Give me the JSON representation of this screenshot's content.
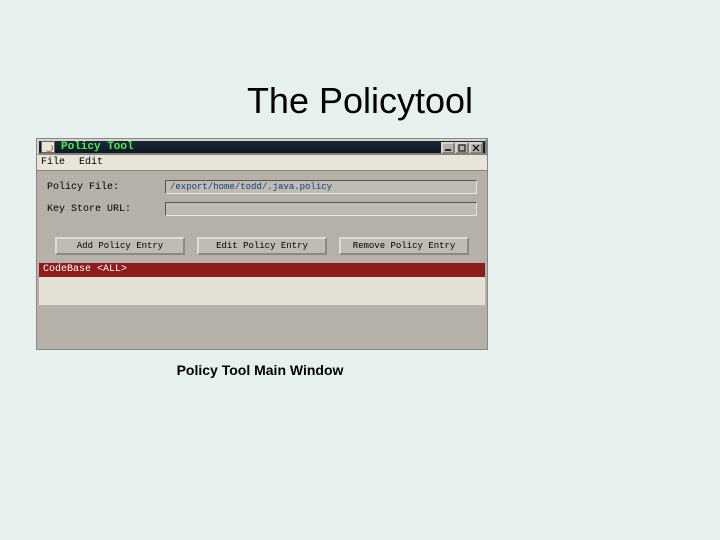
{
  "slide": {
    "title": "The Policytool",
    "caption": "Policy Tool Main Window"
  },
  "window": {
    "title": "Policy Tool",
    "menus": {
      "file": "File",
      "edit": "Edit"
    },
    "form": {
      "policy_file_label": "Policy File:",
      "policy_file_value": "/export/home/todd/.java.policy",
      "keystore_label": "Key Store URL:",
      "keystore_value": ""
    },
    "buttons": {
      "add": "Add Policy Entry",
      "edit": "Edit Policy Entry",
      "remove": "Remove Policy Entry"
    },
    "list": {
      "selected": "CodeBase <ALL>"
    }
  }
}
